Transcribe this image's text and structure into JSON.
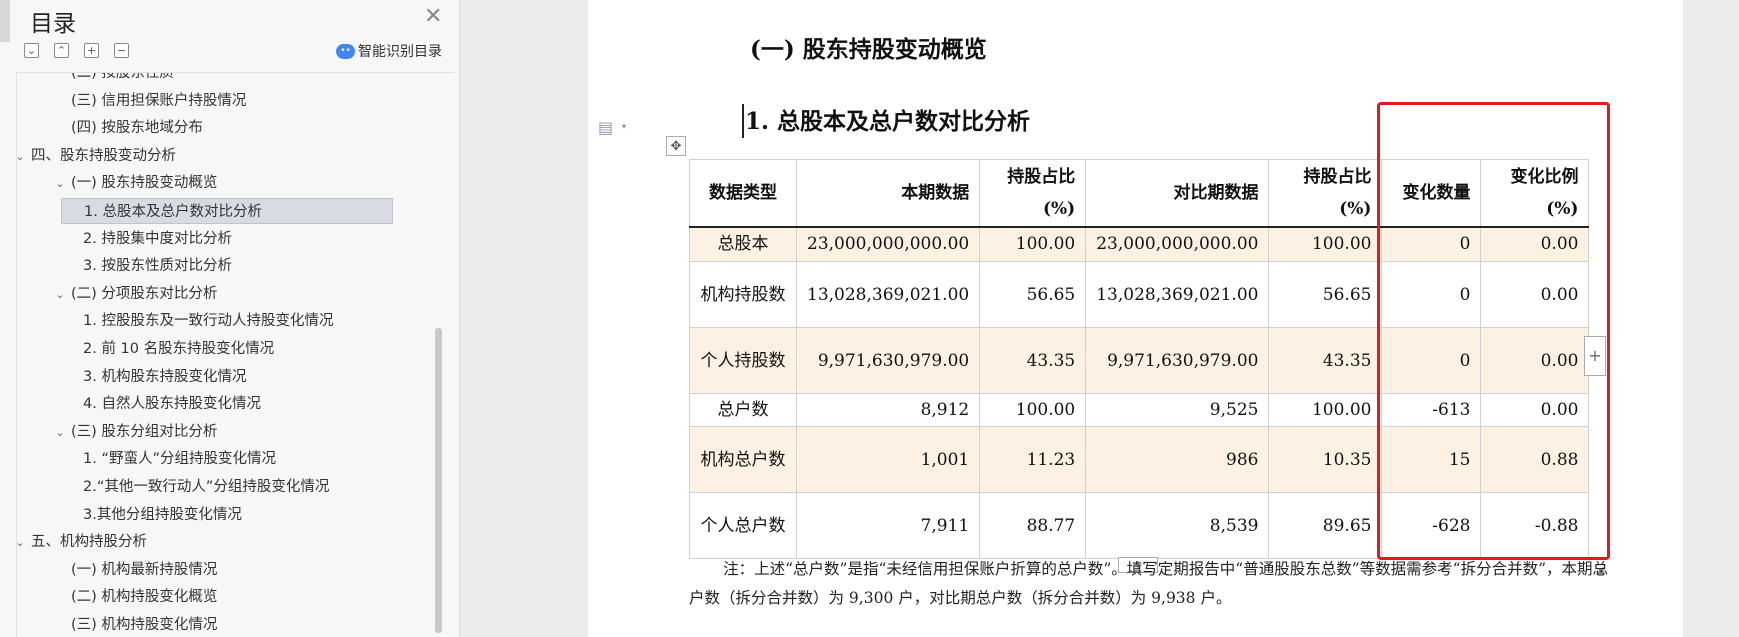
{
  "sidebar": {
    "title": "目录",
    "smart_label": "智能识别目录",
    "tree": [
      {
        "label": "(二) 按股东性质",
        "level": 2
      },
      {
        "label": "(三) 信用担保账户持股情况",
        "level": 2
      },
      {
        "label": "(四) 按股东地域分布",
        "level": 2
      },
      {
        "label": "四、股东持股变动分析",
        "level": 1,
        "expandable": true
      },
      {
        "label": "(一) 股东持股变动概览",
        "level": 2,
        "expandable": true
      },
      {
        "label": "1. 总股本及总户数对比分析",
        "level": 3,
        "selected": true
      },
      {
        "label": "2. 持股集中度对比分析",
        "level": 3
      },
      {
        "label": "3. 按股东性质对比分析",
        "level": 3
      },
      {
        "label": "(二) 分项股东对比分析",
        "level": 2,
        "expandable": true
      },
      {
        "label": "1. 控股股东及一致行动人持股变化情况",
        "level": 3
      },
      {
        "label": "2. 前 10 名股东持股变化情况",
        "level": 3
      },
      {
        "label": "3. 机构股东持股变化情况",
        "level": 3
      },
      {
        "label": "4. 自然人股东持股变化情况",
        "level": 3
      },
      {
        "label": "(三) 股东分组对比分析",
        "level": 2,
        "expandable": true
      },
      {
        "label": "1. “野蛮人”分组持股变化情况",
        "level": 3
      },
      {
        "label": "2.“其他一致行动人”分组持股变化情况",
        "level": 3
      },
      {
        "label": "3.其他分组持股变化情况",
        "level": 3
      },
      {
        "label": "五、机构持股分析",
        "level": 1,
        "expandable": true
      },
      {
        "label": "(一) 机构最新持股情况",
        "level": 2
      },
      {
        "label": "(二) 机构持股变化概览",
        "level": 2
      },
      {
        "label": "(三) 机构持股变化情况",
        "level": 2
      }
    ]
  },
  "document": {
    "heading_1": "(一) 股东持股变动概览",
    "heading_2": "1. 总股本及总户数对比分析",
    "table": {
      "headers": [
        "数据类型",
        "本期数据",
        "持股占比(%)",
        "对比期数据",
        "持股占比(%)",
        "变化数量",
        "变化比例(%)"
      ],
      "rows": [
        [
          "总股本",
          "23,000,000,000.00",
          "100.00",
          "23,000,000,000.00",
          "100.00",
          "0",
          "0.00"
        ],
        [
          "机构持股数",
          "13,028,369,021.00",
          "56.65",
          "13,028,369,021.00",
          "56.65",
          "0",
          "0.00"
        ],
        [
          "个人持股数",
          "9,971,630,979.00",
          "43.35",
          "9,971,630,979.00",
          "43.35",
          "0",
          "0.00"
        ],
        [
          "总户数",
          "8,912",
          "100.00",
          "9,525",
          "100.00",
          "-613",
          "0.00"
        ],
        [
          "机构总户数",
          "1,001",
          "11.23",
          "986",
          "10.35",
          "15",
          "0.88"
        ],
        [
          "个人总户数",
          "7,911",
          "88.77",
          "8,539",
          "89.65",
          "-628",
          "-0.88"
        ]
      ]
    },
    "note": "注：上述“总户数”是指“未经信用担保账户折算的总户数”。填写定期报告中“普通股股东总数”等数据需参考“拆分合并数”，本期总户数（拆分合并数）为 9,300 户，对比期总户数（拆分合并数）为 9,938 户。"
  },
  "colors": {
    "highlight_border": "#e5191c",
    "shaded_row": "#fdf1e4",
    "smart_icon": "#3d86f4"
  }
}
